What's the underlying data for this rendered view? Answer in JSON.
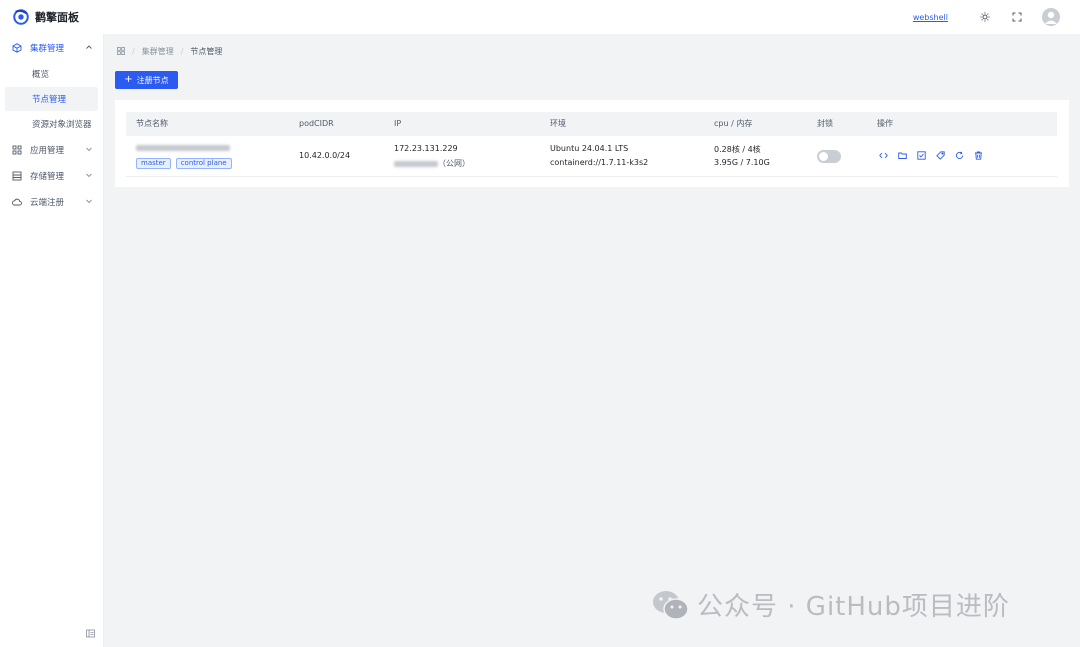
{
  "header": {
    "brand": "鹳擎面板",
    "webshell_link": "webshell",
    "icons": [
      "logo-icon",
      "sun-icon",
      "fullscreen-icon",
      "user-avatar-icon"
    ]
  },
  "sidebar": {
    "groups": [
      {
        "label": "集群管理",
        "icon": "cube-icon",
        "expanded": true,
        "items": [
          {
            "label": "概览"
          },
          {
            "label": "节点管理",
            "selected": true
          },
          {
            "label": "资源对象浏览器"
          }
        ]
      },
      {
        "label": "应用管理",
        "icon": "apps-icon",
        "expanded": false
      },
      {
        "label": "存储管理",
        "icon": "storage-icon",
        "expanded": false
      },
      {
        "label": "云端注册",
        "icon": "cloud-icon",
        "expanded": false
      }
    ]
  },
  "breadcrumb": [
    "集群管理",
    "节点管理"
  ],
  "add_button": {
    "label": "注册节点"
  },
  "table": {
    "columns": [
      "节点名称",
      "podCIDR",
      "IP",
      "环境",
      "cpu / 内存",
      "封锁",
      "操作"
    ],
    "rows": [
      {
        "tags": [
          "master",
          "control plane"
        ],
        "pod_cidr": "10.42.0.0/24",
        "ip_private": "172.23.131.229",
        "ip_public_suffix": "（公网）",
        "env_os": "Ubuntu 24.04.1 LTS",
        "env_runtime": "containerd://1.7.11-k3s2",
        "cpu": "0.28核 / 4核",
        "memory": "3.95G / 7.10G",
        "cordoned": false
      }
    ]
  },
  "row_actions": [
    "code-icon",
    "folder-icon",
    "checklist-icon",
    "tag-icon",
    "refresh-icon",
    "trash-icon"
  ],
  "watermark": "公众号 · GitHub项目进阶",
  "colors": {
    "accent": "#2b5bf0",
    "background": "#f2f3f5",
    "border": "#eceef2"
  }
}
